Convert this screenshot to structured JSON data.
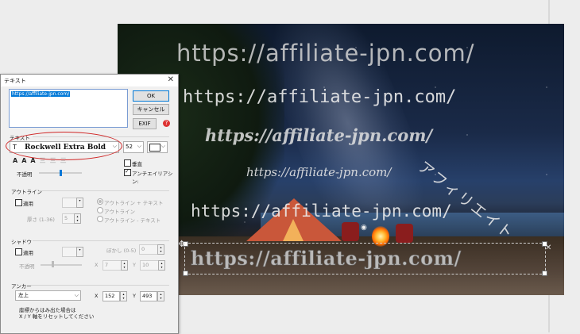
{
  "watermarks": [
    "https://affiliate-jpn.com/",
    "https://affiliate-jpn.com/",
    "https://affiliate-jpn.com/",
    "https://affiliate-jpn.com/",
    "アフィリエイト",
    "https://affiliate-jpn.com/",
    "https://affiliate-jpn.com/"
  ],
  "dialog": {
    "title": "テキスト",
    "close": "✕",
    "text_value": "https://affiliate-jpn.com/",
    "ok": "OK",
    "cancel": "キャンセル",
    "exif": "EXIF",
    "help": "?",
    "text_section": {
      "label": "テキスト",
      "font": "Rockwell Extra Bold",
      "font_icon": "T",
      "size": "52",
      "styles": [
        "A",
        "A",
        "A"
      ],
      "styles_disabled": [
        "三",
        "三",
        "三"
      ],
      "vertical_label": "垂直",
      "vertical_checked": false,
      "opacity_label": "不透明",
      "antialias_label": "アンチエイリアシン:",
      "antialias_checked": true,
      "color": "#ffffff"
    },
    "outline": {
      "label": "アウトライン",
      "apply_label": "適用",
      "apply_checked": false,
      "thickness_label": "厚さ (1-36)",
      "thickness": "5",
      "options": [
        "アウトライン + テキスト",
        "アウトライン",
        "アウトライン - テキスト"
      ],
      "selected_option": 0
    },
    "shadow": {
      "label": "シャドウ",
      "apply_label": "適用",
      "apply_checked": false,
      "blur_label": "ぼかし (0-5)",
      "blur": "0",
      "opacity_label": "不透明",
      "x_label": "X",
      "x": "7",
      "y_label": "Y",
      "y": "10"
    },
    "anchor": {
      "label": "アンカー",
      "position": "左上",
      "x_label": "X",
      "x": "152",
      "y_label": "Y",
      "y": "493",
      "note_line1": "座標からはみ出た場合は",
      "note_line2": "X / Y 軸をリセットしてください"
    }
  }
}
